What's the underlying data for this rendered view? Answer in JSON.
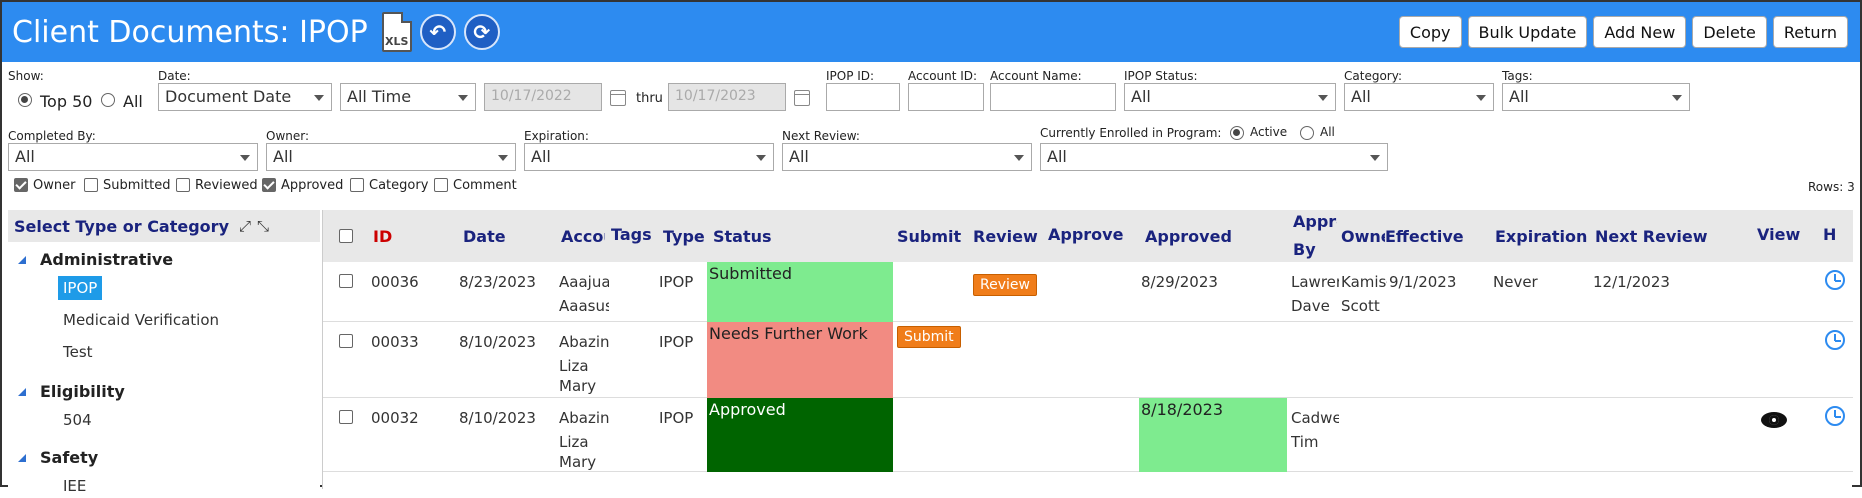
{
  "header": {
    "title": "Client Documents: IPOP",
    "xls_label": "XLS",
    "buttons": [
      "Copy",
      "Bulk Update",
      "Add New",
      "Delete",
      "Return"
    ]
  },
  "filters": {
    "show_label": "Show:",
    "show_options": [
      "Top 50",
      "All"
    ],
    "date_label": "Date:",
    "date_field": "Document Date",
    "date_range": "All Time",
    "date_from": "10/17/2022",
    "thru_label": "thru",
    "date_to": "10/17/2023",
    "ipop_id_label": "IPOP ID:",
    "account_id_label": "Account ID:",
    "account_name_label": "Account Name:",
    "ipop_status_label": "IPOP Status:",
    "ipop_status_value": "All",
    "category_label": "Category:",
    "category_value": "All",
    "tags_label": "Tags:",
    "tags_value": "All",
    "completed_by_label": "Completed By:",
    "completed_by_value": "All",
    "owner_label": "Owner:",
    "owner_value": "All",
    "expiration_label": "Expiration:",
    "expiration_value": "All",
    "next_review_label": "Next Review:",
    "next_review_value": "All",
    "enrolled_label": "Currently Enrolled in Program:",
    "enrolled_options": [
      "Active",
      "All"
    ],
    "enrolled_value": "All",
    "columns_toggles": [
      "Owner",
      "Submitted",
      "Reviewed",
      "Approved",
      "Category",
      "Comment"
    ],
    "rows_count": "Rows: 3"
  },
  "left_panel": {
    "title": "Select Type or Category",
    "groups": [
      {
        "name": "Administrative",
        "items": [
          "IPOP",
          "Medicaid Verification",
          "Test"
        ]
      },
      {
        "name": "Eligibility",
        "items": [
          "504"
        ]
      },
      {
        "name": "Safety",
        "items": [
          "IEE"
        ]
      }
    ]
  },
  "grid": {
    "columns": [
      "ID",
      "Date",
      "Accou",
      "Tags",
      "Type",
      "Status",
      "Submit",
      "Review",
      "Approve",
      "Approved",
      "Appro",
      "By",
      "Owne",
      "Effective",
      "Expiration",
      "Next Review",
      "View",
      "H"
    ],
    "rows": [
      {
        "id": "00036",
        "date": "8/23/2023",
        "account": [
          "Aaajua",
          "Aaasus"
        ],
        "type": "IPOP",
        "status": "Submitted",
        "status_color": "#7eeb8f",
        "submit": "",
        "review": "Review",
        "approved": "8/29/2023",
        "approved_by": [
          "Lawrer",
          "Dave"
        ],
        "owner": [
          "Kamisł",
          "Scott"
        ],
        "effective": "9/1/2023",
        "expiration": "Never",
        "next_review": "12/1/2023"
      },
      {
        "id": "00033",
        "date": "8/10/2023",
        "account": [
          "Abazin",
          "Liza",
          "Mary"
        ],
        "type": "IPOP",
        "status": "Needs Further Work",
        "status_color": "#f28b82",
        "submit": "Submit",
        "review": "",
        "approved": "",
        "approved_by": [],
        "owner": [],
        "effective": "",
        "expiration": "",
        "next_review": ""
      },
      {
        "id": "00032",
        "date": "8/10/2023",
        "account": [
          "Abazin",
          "Liza",
          "Mary"
        ],
        "type": "IPOP",
        "status": "Approved",
        "status_color": "#006400",
        "submit": "",
        "review": "",
        "approved": "8/18/2023",
        "approved_by": [
          "Cadwe",
          "Tim"
        ],
        "owner": [],
        "effective": "",
        "expiration": "",
        "next_review": ""
      }
    ]
  },
  "colors": {
    "header_bg": "#2d8bf0",
    "header_text": "#ffffff",
    "column_header_text": "#1a237e",
    "id_header_text": "#cc0000",
    "action_button": "#f07d1a",
    "selected_item": "#1e9be8",
    "approved_date_bg": "#7eeb8f"
  }
}
